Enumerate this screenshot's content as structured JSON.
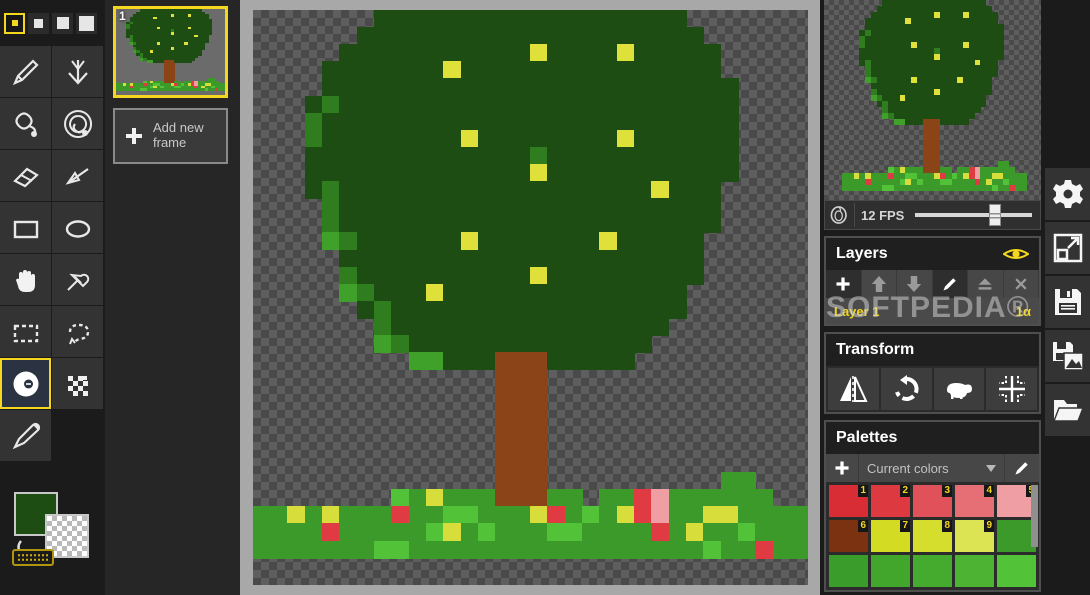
{
  "app": {
    "watermark": "SOFTPEDIA®"
  },
  "toolbar": {
    "brush_sizes": [
      {
        "name": "brush-size-1",
        "selected": true
      },
      {
        "name": "brush-size-2",
        "selected": false
      },
      {
        "name": "brush-size-3",
        "selected": false
      },
      {
        "name": "brush-size-4",
        "selected": false
      }
    ],
    "tools": [
      {
        "id": "pencil",
        "icon": "pencil-icon",
        "selected": false
      },
      {
        "id": "fill-down",
        "icon": "arrow-down-icon",
        "selected": false
      },
      {
        "id": "bucket",
        "icon": "paint-bucket-icon",
        "selected": false
      },
      {
        "id": "bucket-all",
        "icon": "global-fill-icon",
        "selected": false
      },
      {
        "id": "eraser",
        "icon": "eraser-icon",
        "selected": false
      },
      {
        "id": "line",
        "icon": "line-tool-icon",
        "selected": false
      },
      {
        "id": "rectangle",
        "icon": "rectangle-icon",
        "selected": false
      },
      {
        "id": "ellipse",
        "icon": "ellipse-icon",
        "selected": false
      },
      {
        "id": "pan",
        "icon": "hand-icon",
        "selected": false
      },
      {
        "id": "eyedropper",
        "icon": "color-picker-icon",
        "selected": false
      },
      {
        "id": "rect-select",
        "icon": "marquee-select-icon",
        "selected": false
      },
      {
        "id": "lasso",
        "icon": "lasso-select-icon",
        "selected": false
      },
      {
        "id": "shade",
        "icon": "dodge-burn-icon",
        "selected": true
      },
      {
        "id": "dither",
        "icon": "dither-icon",
        "selected": false
      },
      {
        "id": "brush",
        "icon": "brush-icon",
        "selected": false
      }
    ],
    "primary_color": "#1d4d13",
    "secondary_color": "transparent",
    "swap_icon": "swap-colors-icon",
    "keyboard_icon": "keyboard-icon"
  },
  "frames": {
    "items": [
      {
        "number": "1",
        "selected": true
      }
    ],
    "add_label": "Add new\nframe",
    "add_icon": "plus-icon"
  },
  "preview": {
    "onion_icon": "onion-skin-icon",
    "fps_label": "12 FPS",
    "fps_value": 12,
    "fps_percent": 63
  },
  "layers": {
    "title": "Layers",
    "visibility_icon": "eye-icon",
    "buttons": [
      {
        "id": "add-layer",
        "icon": "plus-icon",
        "dim": false
      },
      {
        "id": "move-up",
        "icon": "arrow-up-icon",
        "dim": true
      },
      {
        "id": "move-down",
        "icon": "arrow-down-icon",
        "dim": true
      },
      {
        "id": "edit-layer",
        "icon": "pencil-icon",
        "dim": false
      },
      {
        "id": "merge-layer",
        "icon": "merge-icon",
        "dim": true
      },
      {
        "id": "delete-layer",
        "icon": "close-icon",
        "dim": true
      }
    ],
    "rows": [
      {
        "name": "Layer 1",
        "alpha": "1α",
        "selected": true
      }
    ]
  },
  "transform": {
    "title": "Transform",
    "buttons": [
      {
        "id": "mirror",
        "icon": "mirror-horizontal-icon"
      },
      {
        "id": "rotate",
        "icon": "rotate-ccw-icon"
      },
      {
        "id": "sheep",
        "icon": "sheep-icon"
      },
      {
        "id": "crop",
        "icon": "crop-center-icon"
      }
    ]
  },
  "palettes": {
    "title": "Palettes",
    "add_icon": "plus-icon",
    "selected": "Current colors",
    "dropdown_icon": "chevron-down-icon",
    "edit_icon": "pencil-icon",
    "swatches": [
      {
        "n": "1",
        "color": "#d82d35"
      },
      {
        "n": "2",
        "color": "#dc3941"
      },
      {
        "n": "3",
        "color": "#e05159"
      },
      {
        "n": "4",
        "color": "#e66f76"
      },
      {
        "n": "5",
        "color": "#ef9fa3"
      },
      {
        "n": "6",
        "color": "#7a3210"
      },
      {
        "n": "7",
        "color": "#d3dc22"
      },
      {
        "n": "8",
        "color": "#d5de2c"
      },
      {
        "n": "9",
        "color": "#dde453"
      },
      {
        "n": "",
        "color": "#3b9a29"
      },
      {
        "n": "",
        "color": "#3a9c2a"
      },
      {
        "n": "",
        "color": "#42a52c"
      },
      {
        "n": "",
        "color": "#45ab2e"
      },
      {
        "n": "",
        "color": "#4cb432"
      },
      {
        "n": "",
        "color": "#52c238"
      }
    ]
  },
  "sidebar_icons": [
    {
      "id": "settings",
      "icon": "gear-icon"
    },
    {
      "id": "resize-canvas",
      "icon": "resize-icon"
    },
    {
      "id": "save",
      "icon": "save-icon"
    },
    {
      "id": "export-image",
      "icon": "save-image-icon"
    },
    {
      "id": "open",
      "icon": "folder-open-icon"
    }
  ],
  "artwork": {
    "description": "Pixel-art apple tree with green canopy, brown trunk and flowered grass",
    "colors": {
      "canopy_dark": "#1d4d13",
      "canopy_mid": "#2f7d1f",
      "canopy_light": "#3fa02a",
      "fruit": "#e0e03a",
      "trunk": "#8a4418",
      "grass": "#3b9a29",
      "grass_light": "#52c238",
      "flower_red": "#e03a42",
      "flower_pink": "#ef9fa3",
      "flower_yellow": "#d7de3c"
    }
  }
}
